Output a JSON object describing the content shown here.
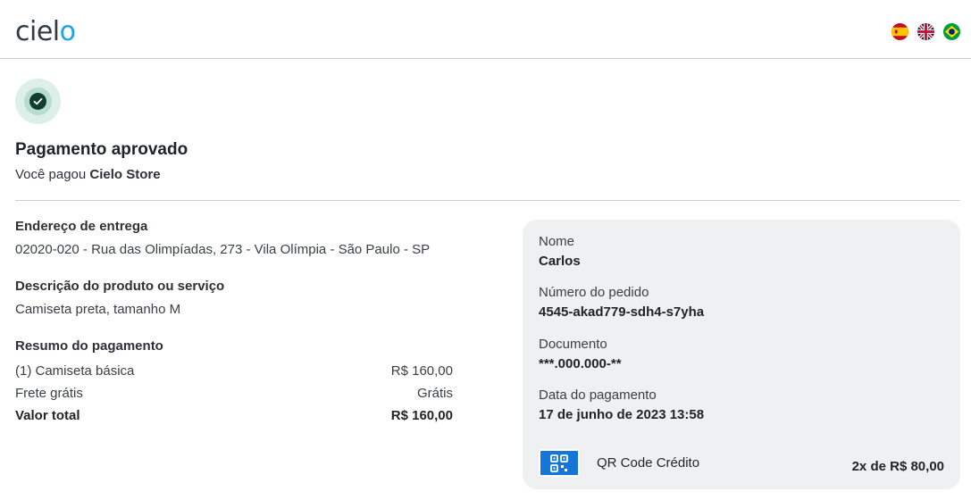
{
  "header": {
    "logo_text_a": "ciel",
    "logo_text_b": "o",
    "flags": [
      "es",
      "gb",
      "br"
    ]
  },
  "status": {
    "title": "Pagamento aprovado",
    "subtitle_prefix": "Você pagou ",
    "merchant": "Cielo Store"
  },
  "shipping": {
    "label": "Endereço de entrega",
    "address": "02020-020 - Rua das Olimpíadas, 273 - Vila Olímpia - São Paulo - SP"
  },
  "product": {
    "label": "Descrição do produto ou serviço",
    "description": "Camiseta preta, tamanho M"
  },
  "summary": {
    "label": "Resumo do pagamento",
    "rows": [
      {
        "name": "(1) Camiseta básica",
        "value": "R$ 160,00"
      },
      {
        "name": "Frete grátis",
        "value": "Grátis"
      },
      {
        "name": "Valor total",
        "value": "R$ 160,00"
      }
    ]
  },
  "details": {
    "name_label": "Nome",
    "name_value": "Carlos",
    "order_label": "Número do pedido",
    "order_value": "4545-akad779-sdh4-s7yha",
    "document_label": "Documento",
    "document_value": "***.000.000-**",
    "date_label": "Data do pagamento",
    "date_value": "17 de junho de 2023 13:58",
    "payment_method": "QR Code Crédito",
    "installments": "2x de R$ 80,00"
  },
  "colors": {
    "brand_blue": "#1aa6e6",
    "success_dark": "#0f3d2e",
    "qr_blue": "#1576d8"
  }
}
